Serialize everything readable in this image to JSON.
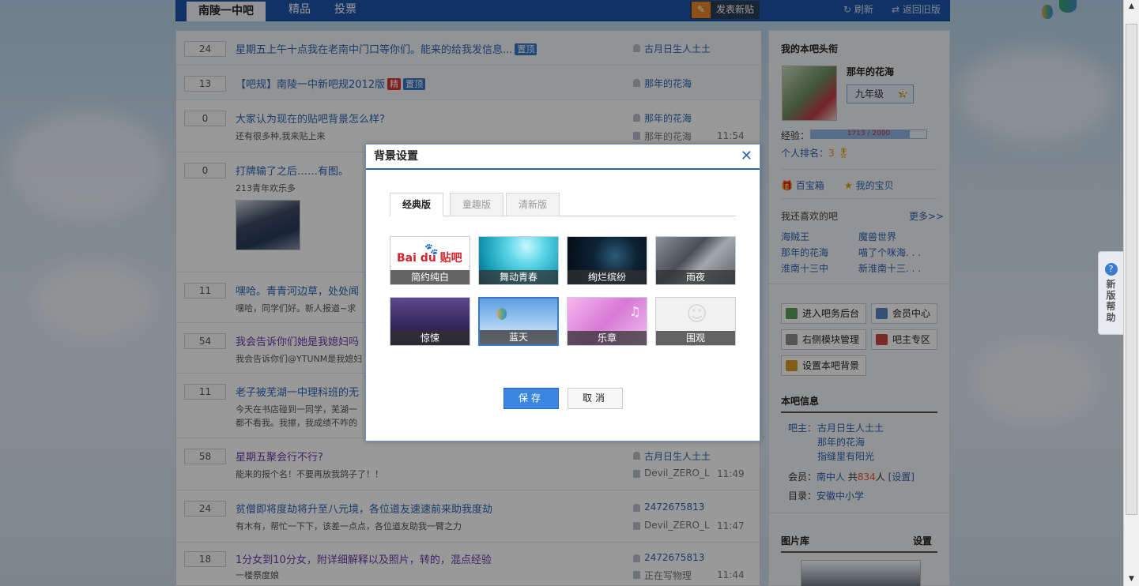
{
  "nav": {
    "forum_tab": "南陵一中吧",
    "tabs": [
      "精品",
      "投票"
    ],
    "post_button": "发表新贴",
    "refresh": "刷新",
    "old_version": "返回旧版"
  },
  "threads": [
    {
      "count": "24",
      "title": "星期五上午十点我在老南中门口等你们。能来的给我发信息...",
      "badges": [
        "置顶"
      ],
      "author": "古月日生人土土"
    },
    {
      "count": "13",
      "title": "【吧规】南陵一中新吧规2012版",
      "badges": [
        "精",
        "置顶"
      ],
      "author": "那年的花海"
    },
    {
      "count": "0",
      "title": "大家认为现在的贴吧背景怎么样?",
      "abstract": "还有很多种,我来贴上来",
      "author": "那年的花海",
      "last_reply": "那年的花海",
      "time": "11:54"
    },
    {
      "count": "0",
      "title": "打牌输了之后……有图。",
      "abstract": "213青年欢乐多"
    },
    {
      "count": "11",
      "title": "嘿哈。青青河边草，处处闻",
      "abstract": "嘿哈，同学们好。新人报道~求"
    },
    {
      "count": "54",
      "title": "我会告诉你们她是我媳妇吗",
      "abstract": "我会告诉你们@YTUNM是我媳妇"
    },
    {
      "count": "11",
      "title": "老子被芜湖一中理科班的无",
      "abstract": "今天在书店碰到一同学，芜湖一",
      "abstract2": "都不看我。我擦，我成绩不咋的"
    },
    {
      "count": "58",
      "title": "星期五聚会行不行?",
      "abstract": "能来的报个名！不要再放我鸽子了！！",
      "author": "古月日生人土土",
      "last_reply": "Devil_ZERO_L",
      "time": "11:49"
    },
    {
      "count": "24",
      "title": "贫僧即将度劫将升至八元境，各位道友速速前来助我度劫",
      "abstract": "有木有，帮忙一下下，该差一点点，各位道友助我一臂之力",
      "author": "2472675813",
      "last_reply": "Devil_ZERO_L",
      "time": "11:47"
    },
    {
      "count": "18",
      "title": "1分女到10分女，附详细解释以及照片，转的，混点经验",
      "abstract": "一楼祭度娘",
      "author": "2472675813",
      "last_reply": "正在写物理",
      "time": "11:44"
    }
  ],
  "sidebar": {
    "title_header": "我的本吧头衔",
    "username": "那年的花海",
    "grade": "九年级",
    "grade_level": "9",
    "exp_label": "经验：",
    "exp_text": "1713 / 2000",
    "exp_fraction": 0.8565,
    "rank_label": "个人排名：",
    "rank_value": "3",
    "treasure_box": "百宝箱",
    "my_treasure": "我的宝贝",
    "liked_title": "我还喜欢的吧",
    "more": "更多>>",
    "liked": [
      "海贼王",
      "魔兽世界",
      "那年的花海",
      "喵了个咪海. . .",
      "淮南十三中",
      "新淮南十三. . ."
    ],
    "btns": [
      "进入吧务后台",
      "会员中心",
      "右侧模块管理",
      "吧主专区",
      "设置本吧背景"
    ],
    "info_title": "本吧信息",
    "owner_label": "吧主：",
    "owners": [
      "古月日生人土土",
      "那年的花海",
      "指缝里有阳光"
    ],
    "member_label": "会员：",
    "member_name": "南中人",
    "member_total_prefix": "共",
    "member_count": "834",
    "member_unit": "人",
    "member_setting": "[设置]",
    "dir_label": "目录：",
    "dir_value": "安徽中小学",
    "gallery_title": "图片库",
    "gallery_setting": "设置"
  },
  "help": {
    "text": "新版帮助"
  },
  "dialog": {
    "title": "背景设置",
    "tabs": [
      "经典版",
      "童趣版",
      "清新版"
    ],
    "baidu_logo": "Bai du 贴吧",
    "themes": [
      "简约纯白",
      "舞动青春",
      "绚烂缤纷",
      "雨夜",
      "惊悚",
      "蓝天",
      "乐章",
      "围观"
    ],
    "save": "保存",
    "cancel": "取消"
  },
  "colors": {
    "nav_blue": "#1d54a9",
    "link": "#2d64b3",
    "accent_orange": "#e9872a"
  }
}
